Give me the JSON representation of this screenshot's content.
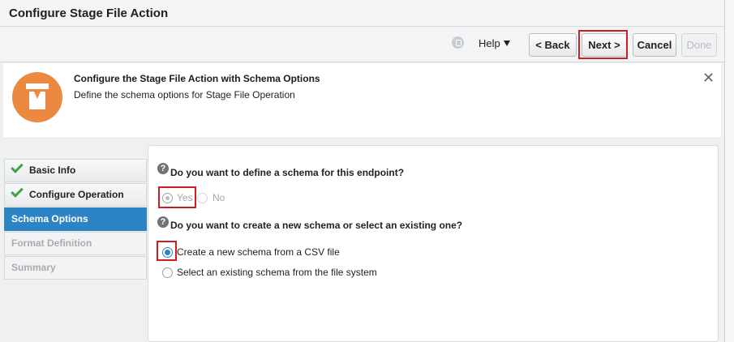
{
  "window": {
    "title": "Configure Stage File Action"
  },
  "toolbar": {
    "help_label": "Help",
    "back_label": "< Back",
    "next_label": "Next >",
    "cancel_label": "Cancel",
    "done_label": "Done"
  },
  "banner": {
    "title": "Configure the Stage File Action with Schema Options",
    "subtitle": "Define the schema options for Stage File Operation",
    "close_glyph": "✕"
  },
  "sidebar": {
    "items": [
      {
        "label": "Basic Info",
        "state": "completed"
      },
      {
        "label": "Configure Operation",
        "state": "completed"
      },
      {
        "label": "Schema Options",
        "state": "active"
      },
      {
        "label": "Format Definition",
        "state": "disabled"
      },
      {
        "label": "Summary",
        "state": "disabled"
      }
    ]
  },
  "main": {
    "q1": {
      "icon": "?",
      "text": "Do you want to define a schema for this endpoint?",
      "options": [
        "Yes",
        "No"
      ],
      "selected": "Yes"
    },
    "q2": {
      "icon": "?",
      "text": "Do you want to create a new schema or select an existing one?",
      "options": [
        "Create a new schema from a CSV file",
        "Select an existing schema from the file system"
      ],
      "selected": "Create a new schema from a CSV file"
    }
  },
  "colors": {
    "accent": "#2c84c4",
    "highlight": "#cf1d20",
    "banner_icon": "#ec8941",
    "check": "#43a047"
  }
}
